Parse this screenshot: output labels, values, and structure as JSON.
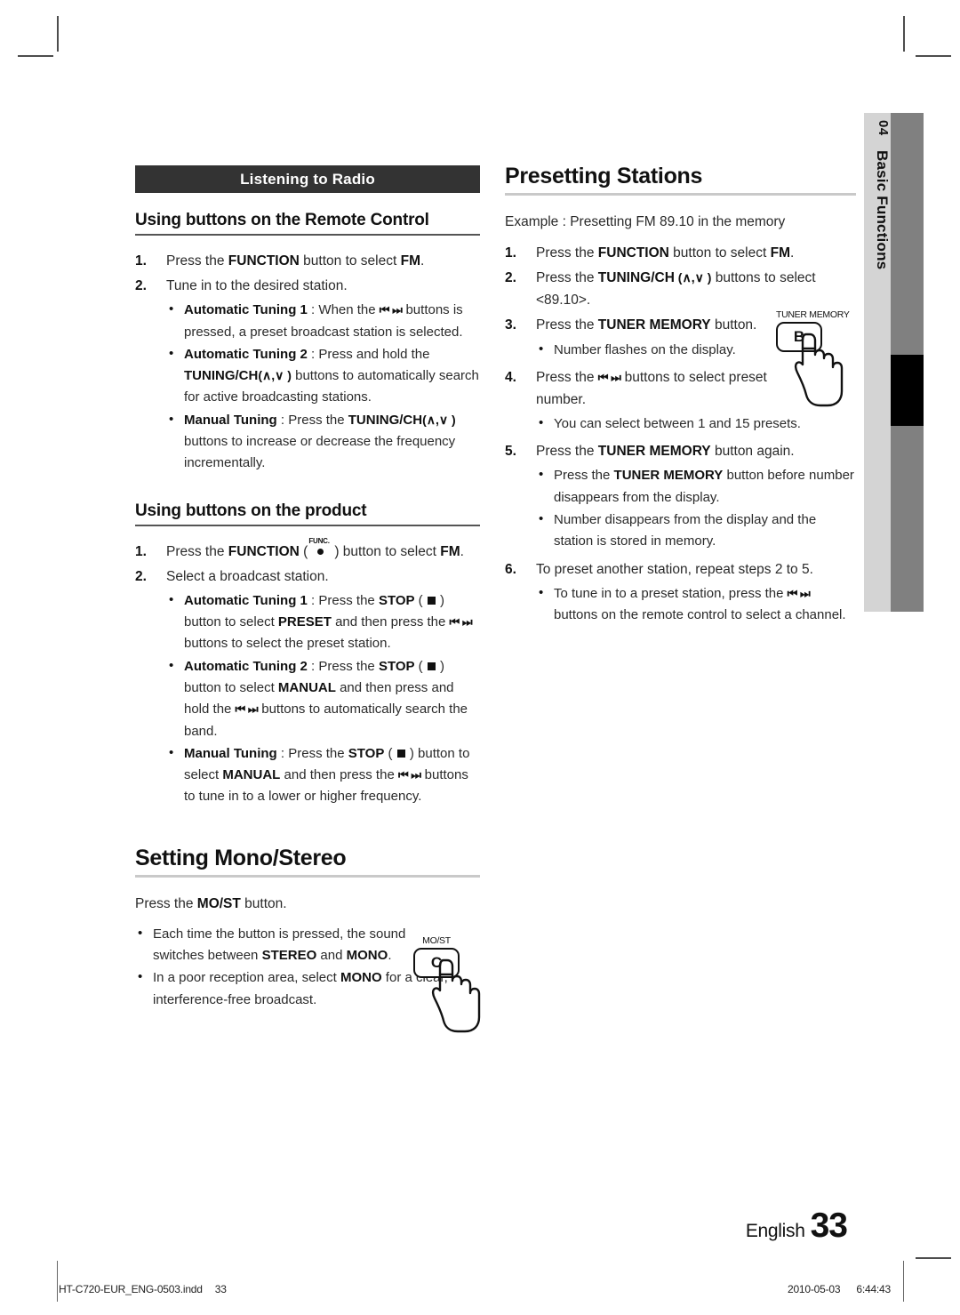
{
  "side_tab": {
    "chapter_number": "04",
    "chapter_label": "Basic Functions"
  },
  "left_column": {
    "title_bar": "Listening to Radio",
    "section_remote": {
      "heading": "Using buttons on the Remote Control",
      "steps": [
        {
          "num": "1.",
          "text_parts": [
            "Press the ",
            "FUNCTION",
            " button to select ",
            "FM",
            "."
          ]
        },
        {
          "num": "2.",
          "text_parts": [
            "Tune in to the desired station."
          ]
        }
      ],
      "step1_prefix": "Press the ",
      "step1_bold1": "FUNCTION",
      "step1_mid": " button to select ",
      "step1_bold2": "FM",
      "step1_suffix": ".",
      "step2_text": "Tune in to the desired station.",
      "bullets": [
        {
          "label": "Automatic Tuning 1",
          "sep": " : ",
          "body_a": "When the ",
          "glyph": "⏮ ⏭",
          "body_b": " buttons is pressed, a preset broadcast station is selected."
        },
        {
          "label": "Automatic Tuning 2",
          "sep": " : ",
          "body_a": "Press and hold the ",
          "bold_b": "TUNING/CH",
          "parens": "(∧,∨ )",
          "body_c": " buttons to automatically search for active broadcasting stations."
        },
        {
          "label": "Manual Tuning",
          "sep": " : ",
          "body_a": "Press the ",
          "bold_b": "TUNING/CH",
          "parens": "(∧,∨ )",
          "body_c": " buttons to increase or decrease the frequency incrementally."
        }
      ]
    },
    "section_product": {
      "heading": "Using buttons on the product",
      "step1": {
        "num": "1.",
        "a": "Press the ",
        "bold1": "FUNCTION",
        "paren_open": " (",
        "func_icon_label": "FUNC.",
        "paren_close": ") ",
        "b": "button to select ",
        "bold2": "FM",
        "c": "."
      },
      "step2": {
        "num": "2.",
        "text": "Select a broadcast station."
      },
      "bullets": [
        {
          "label": "Automatic Tuning 1",
          "sep": " : ",
          "a": "Press the ",
          "bold_stop": "STOP",
          "stop_parens": "(  )",
          "b": " button to select ",
          "bold_mode": "PRESET",
          "c": " and then press the ",
          "glyph": "⏮ ⏭",
          "d": " buttons to select the preset station."
        },
        {
          "label": "Automatic Tuning 2",
          "sep": " : ",
          "a": "Press the ",
          "bold_stop": "STOP",
          "b": " button to select ",
          "bold_mode": "MANUAL",
          "c": " and then press and hold the ",
          "glyph": "⏮ ⏭",
          "d": " buttons to automatically search the band."
        },
        {
          "label": "Manual Tuning",
          "sep": " : ",
          "a": "Press the ",
          "bold_stop": "STOP",
          "b": " button to select ",
          "bold_mode": "MANUAL",
          "c": " and then press the ",
          "glyph": "⏮ ⏭",
          "d": " buttons to tune in to a lower or higher frequency."
        }
      ]
    },
    "section_mono": {
      "heading": "Setting Mono/Stereo",
      "intro_a": "Press the ",
      "intro_bold": "MO/ST",
      "intro_b": " button.",
      "bullets": [
        {
          "a": "Each time the button is pressed, the sound switches between ",
          "bold1": "STEREO",
          "b": " and ",
          "bold2": "MONO",
          "c": "."
        },
        {
          "a": "In a poor reception area, select ",
          "bold1": "MONO",
          "b": " for a clear, interference-free broadcast."
        }
      ],
      "button_illustration": {
        "caption": "MO/ST",
        "key_letter": "C"
      }
    }
  },
  "right_column": {
    "heading": "Presetting Stations",
    "example_line": "Example : Presetting FM 89.10 in the memory",
    "steps": [
      {
        "num": "1.",
        "a": "Press the ",
        "bold1": "FUNCTION",
        "b": " button to select ",
        "bold2": "FM",
        "c": "."
      },
      {
        "num": "2.",
        "a": "Press the ",
        "bold1": "TUNING/CH",
        "parens": " (∧,∨ )",
        "b": " buttons to select <89.10>."
      },
      {
        "num": "3.",
        "a": "Press the ",
        "bold1": "TUNER MEMORY",
        "b": " button.",
        "sub_bullets": [
          "Number flashes on the display."
        ]
      },
      {
        "num": "4.",
        "a": "Press the ",
        "glyph": "⏮ ⏭",
        "b": " buttons to select preset number.",
        "sub_bullets": [
          "You can select between 1 and 15 presets."
        ]
      },
      {
        "num": "5.",
        "a": "Press the ",
        "bold1": "TUNER MEMORY",
        "b": " button again.",
        "sub_bullets_rich": [
          {
            "a": "Press the ",
            "bold": "TUNER MEMORY",
            "b": " button before number disappears from the display."
          },
          {
            "a": "Number disappears from the display and the station is stored in memory.",
            "bold": "",
            "b": ""
          }
        ]
      },
      {
        "num": "6.",
        "a": "To preset another station, repeat steps 2 to 5.",
        "sub_bullet_rich": {
          "a": "To tune in to a preset station, press the ",
          "glyph": "⏮ ⏭",
          "b": " buttons on the remote control to select a channel."
        }
      }
    ],
    "button_illustration": {
      "caption": "TUNER MEMORY",
      "key_letter": "B"
    }
  },
  "footer": {
    "language": "English",
    "page_number": "33",
    "file_name": "HT-C720-EUR_ENG-0503.indd",
    "file_page": "33",
    "date": "2010-05-03",
    "time": "6:44:43"
  }
}
